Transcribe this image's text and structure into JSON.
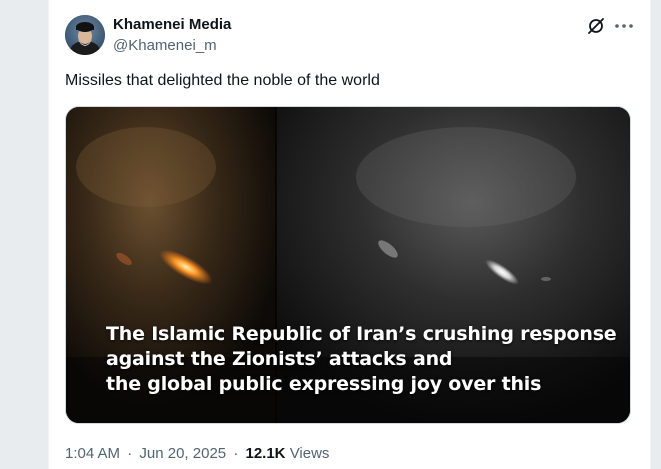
{
  "author": {
    "name": "Khamenei Media",
    "handle": "@Khamenei_m"
  },
  "tweet": {
    "text": "Missiles that delighted the noble of the world"
  },
  "media": {
    "caption_lines": [
      "The Islamic Republic of Iran’s crushing response",
      "against the Zionists’ attacks and",
      "the global public expressing joy over this"
    ]
  },
  "meta": {
    "time": "1:04 AM",
    "separator": "·",
    "date": "Jun 20, 2025",
    "views_count": "12.1K",
    "views_label": "Views"
  },
  "icons": {
    "grok": "grok-icon",
    "more": "more-icon"
  }
}
